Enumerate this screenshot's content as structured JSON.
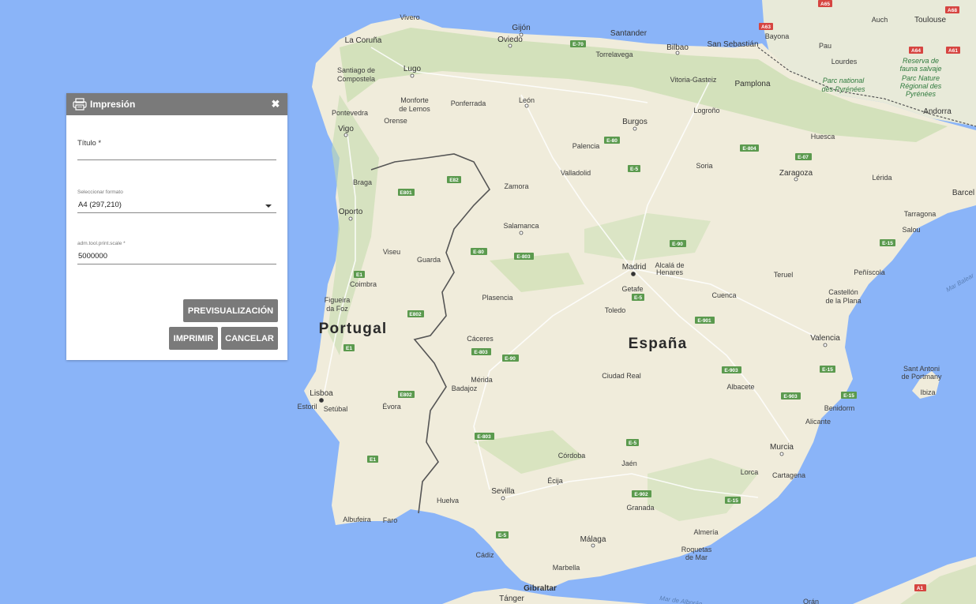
{
  "dialog": {
    "title": "Impresión",
    "fields": {
      "title_label": "Título *",
      "title_value": "",
      "format_label": "Seleccionar formato",
      "format_value": "A4 (297,210)",
      "scale_label": "adm.tool.print.scale *",
      "scale_value": "5000000"
    },
    "buttons": {
      "preview": "PREVISUALIZACIÓN",
      "print": "IMPRIMIR",
      "cancel": "CANCELAR"
    }
  },
  "map": {
    "countries": [
      "Portugal",
      "España"
    ],
    "cities": [
      "Vivero",
      "Gijón",
      "Oviedo",
      "Santander",
      "Bilbao",
      "San Sebastián",
      "Bayona",
      "Auch",
      "Toulouse",
      "La Coruña",
      "Lugo",
      "Santiago de Compostela",
      "Torrelavega",
      "Vitoria-Gasteiz",
      "Pamplona",
      "Pau",
      "Lourdes",
      "Monforte de Lemos",
      "Ponferrada",
      "León",
      "Burgos",
      "Logroño",
      "Andorra",
      "Pontevedra",
      "Vigo",
      "Orense",
      "Palencia",
      "Huesca",
      "Soria",
      "Zaragoza",
      "Lérida",
      "Braga",
      "Valladolid",
      "Zamora",
      "Barcel",
      "Oporto",
      "Salamanca",
      "Tarragona",
      "Salou",
      "Viseu",
      "Guarda",
      "Madrid",
      "Alcalá de Henares",
      "Coimbra",
      "Teruel",
      "Peñíscola",
      "Getafe",
      "Figueira da Foz",
      "Plasencia",
      "Toledo",
      "Cuenca",
      "Castellón de la Plana",
      "Cáceres",
      "Valencia",
      "Ciudad Real",
      "Mérida",
      "Badajoz",
      "Albacete",
      "Lisboa",
      "Estoril",
      "Setúbal",
      "Évora",
      "Benidorm",
      "Alicante",
      "Córdoba",
      "Jaén",
      "Murcia",
      "Lorca",
      "Cartagena",
      "Écija",
      "Sevilla",
      "Huelva",
      "Granada",
      "Albufeira",
      "Faro",
      "Almería",
      "Málaga",
      "Roquetas de Mar",
      "Cádiz",
      "Marbella",
      "Gibraltar",
      "Tánger",
      "Orán",
      "Sant Antoni de Portmany",
      "Ibiza"
    ],
    "parks": [
      "Reserva de fauna salvaje",
      "Parc Nature Régional des Pyrénées",
      "Parc national des Pyrénées"
    ],
    "seas": [
      "Mar Balear",
      "Mar de Alborán"
    ],
    "roads": [
      "A65",
      "A63",
      "A64",
      "A61",
      "A68",
      "E-70",
      "E-80",
      "E-5",
      "E-804",
      "E-07",
      "E82",
      "E801",
      "E-90",
      "E-15",
      "E1",
      "E-803",
      "E-901",
      "E802",
      "E-903",
      "E-902",
      "E-5",
      "A1",
      "E-80"
    ]
  },
  "colors": {
    "water": "#8ab4f8",
    "land": "#f2efe4",
    "header": "#7a7a7a",
    "border": "#555555"
  }
}
